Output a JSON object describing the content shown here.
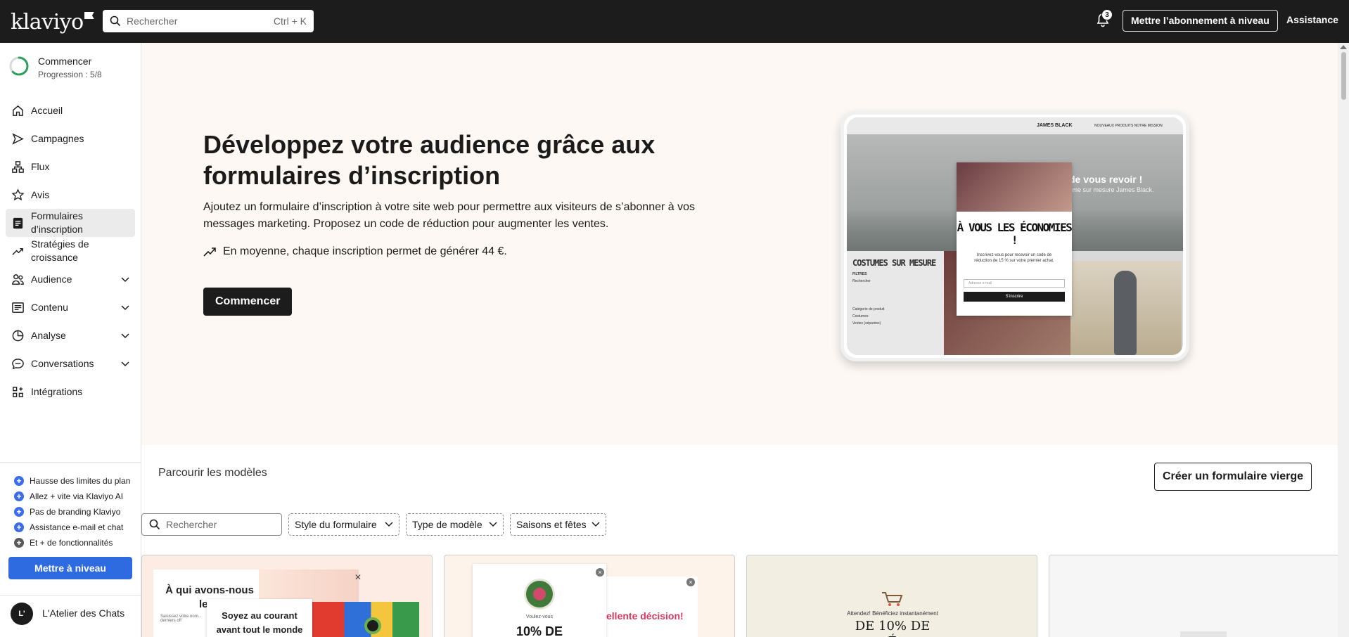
{
  "topbar": {
    "logo": "klaviyo",
    "search_placeholder": "Rechercher",
    "search_shortcut": "Ctrl + K",
    "notification_count": "3",
    "upgrade_label": "Mettre l’abonnement à niveau",
    "assistance_label": "Assistance"
  },
  "sidebar": {
    "progress_title": "Commencer",
    "progress_sub": "Progression : 5/8",
    "progress_fraction": 0.625,
    "items": [
      {
        "label": "Accueil",
        "icon": "home-icon"
      },
      {
        "label": "Campagnes",
        "icon": "send-icon"
      },
      {
        "label": "Flux",
        "icon": "flow-icon"
      },
      {
        "label": "Avis",
        "icon": "star-icon"
      },
      {
        "label": "Formulaires d’inscription",
        "icon": "form-icon",
        "active": true
      },
      {
        "label": "Stratégies de croissance",
        "icon": "trend-icon"
      },
      {
        "label": "Audience",
        "icon": "audience-icon",
        "expandable": true
      },
      {
        "label": "Contenu",
        "icon": "content-icon",
        "expandable": true
      },
      {
        "label": "Analyse",
        "icon": "pie-chart-icon",
        "expandable": true
      },
      {
        "label": "Conversations",
        "icon": "chat-icon",
        "expandable": true
      },
      {
        "label": "Intégrations",
        "icon": "integrations-icon"
      }
    ],
    "perks": [
      "Hausse des limites du plan",
      "Allez + vite via Klaviyo AI",
      "Pas de branding Klaviyo",
      "Assistance e-mail et chat",
      "Et + de fonctionnalités"
    ],
    "upgrade_button": "Mettre à niveau",
    "account_initials": "L'",
    "account_name": "L'Atelier des Chats"
  },
  "hero": {
    "title": "Développez votre audience grâce aux formulaires d’inscription",
    "description": "Ajoutez un formulaire d’inscription à votre site web pour permettre aux visiteurs de s’abonner à vos messages marketing. Proposez un code de réduction pour augmenter les ventes.",
    "stat": "En moyenne, chaque inscription permet de générer 44 €.",
    "cta": "Commencer",
    "mock": {
      "brand": "JAMES BLACK",
      "links": "NOUVEAUX PRODUITS   NOTRE MISSION",
      "hello": "de vous revoir !",
      "hello_sub": "sme sur mesure James Black.",
      "section": "COSTUMES SUR MESURE",
      "filters": "FILTRES",
      "search": "Rechercher",
      "category": "Catégorie de produit",
      "opt1": "Costumes",
      "opt2": "Vestes (séparées)",
      "popup_title": "À VOUS LES ÉCONOMIES !",
      "popup_text": "Inscrivez-vous pour recevoir un code de réduction de 15 % sur votre premier achat.",
      "popup_input": "Adresse e-mail",
      "popup_button": "S’inscrire"
    }
  },
  "templates": {
    "title": "Parcourir les modèles",
    "blank_button": "Créer un formulaire vierge",
    "search_placeholder": "Rechercher",
    "filters": [
      "Style du formulaire",
      "Type de modèle",
      "Saisons et fêtes"
    ],
    "cards": {
      "c1_head": "À qui avons-nous le pl",
      "c1_sub": "Saisissez votre nom... derniers off",
      "c1_head2": "Soyez au courant avant tout le monde",
      "c2_sub": "Voulez-vous",
      "c2_head": "10% DE",
      "c2_head2": "ellente décision!",
      "c3_sub": "Attendez! Bénéficiez instantanément",
      "c3_head": "DE 10% DE",
      "c3_head2": "É"
    }
  }
}
